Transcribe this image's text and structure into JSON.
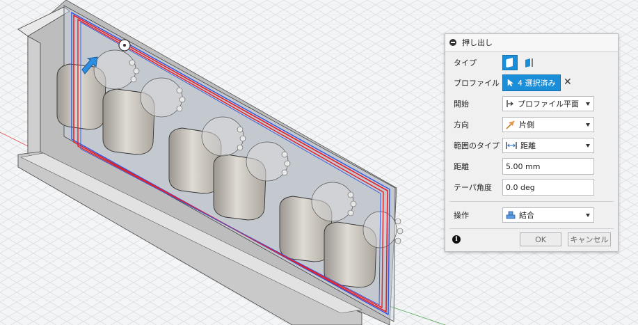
{
  "dialog": {
    "title": "押し出し",
    "type": {
      "label": "タイプ"
    },
    "profile": {
      "label": "プロファイル",
      "selected": "4 選択済み"
    },
    "start": {
      "label": "開始",
      "value": "プロファイル平面"
    },
    "direction": {
      "label": "方向",
      "value": "片側"
    },
    "extent_type": {
      "label": "範囲のタイプ",
      "value": "距離"
    },
    "distance": {
      "label": "距離",
      "value": "5.00 mm"
    },
    "taper_angle": {
      "label": "テーパ角度",
      "value": "0.0 deg"
    },
    "operation": {
      "label": "操作",
      "value": "結合"
    },
    "ok_label": "OK",
    "cancel_label": "キャンセル"
  },
  "colors": {
    "accent": "#1b8ed9",
    "profile_outline": "#e0202c",
    "selection_outline": "#3355dd",
    "grid": "#d4d7db"
  },
  "icons": {
    "collapse": "minus-circle-icon",
    "type_solid": "solid-extrude-icon",
    "type_surface": "surface-extrude-icon",
    "select": "cursor-arrow-icon",
    "clear": "close-icon",
    "start": "profile-plane-icon",
    "direction": "one-side-icon",
    "extent": "distance-icon",
    "operation": "join-icon",
    "info": "info-icon"
  }
}
